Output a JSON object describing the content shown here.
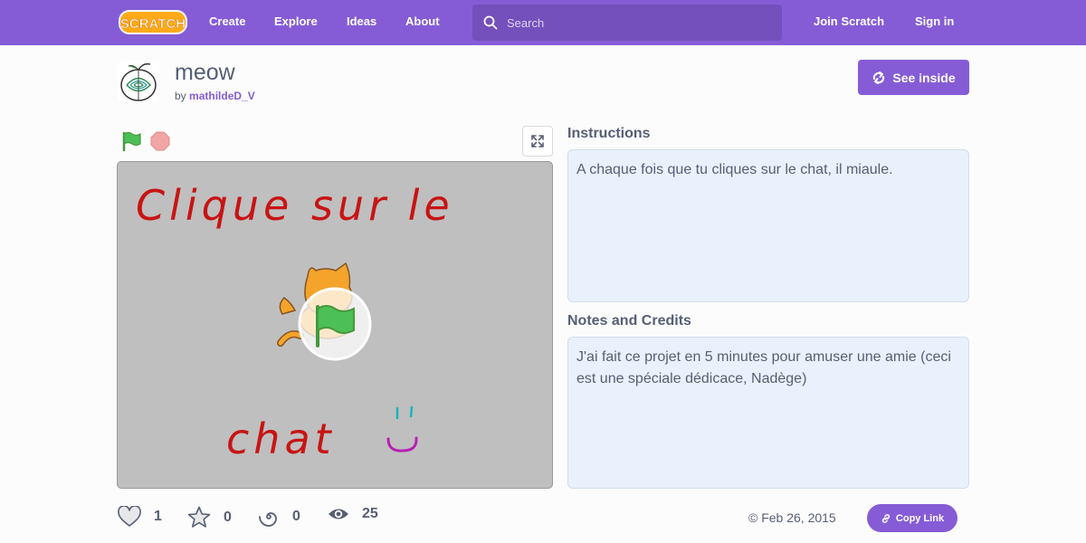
{
  "nav": {
    "logo_text": "SCRATCH",
    "links": [
      "Create",
      "Explore",
      "Ideas",
      "About"
    ],
    "search_placeholder": "Search",
    "join_label": "Join Scratch",
    "signin_label": "Sign in"
  },
  "project": {
    "title": "meow",
    "by_prefix": "by",
    "author": "mathildeD_V",
    "see_inside_label": "See inside"
  },
  "stage": {
    "line1": "Clique sur le",
    "line2": "chat"
  },
  "instructions": {
    "label": "Instructions",
    "text": "A chaque fois que tu cliques sur le chat, il miaule."
  },
  "notes": {
    "label": "Notes and Credits",
    "text": "J'ai fait ce projet en 5 minutes pour amuser une amie (ceci est une spéciale dédicace, Nadège)"
  },
  "stats": {
    "loves": "1",
    "favorites": "0",
    "remixes": "0",
    "views": "25"
  },
  "date": "© Feb 26, 2015",
  "copy_link_label": "Copy Link",
  "colors": {
    "brand": "#855cd6",
    "flag_green": "#4cbf56",
    "stop_red": "#ec5959",
    "stage_bg": "#bfbfbf",
    "drawing_red": "#c81414"
  }
}
